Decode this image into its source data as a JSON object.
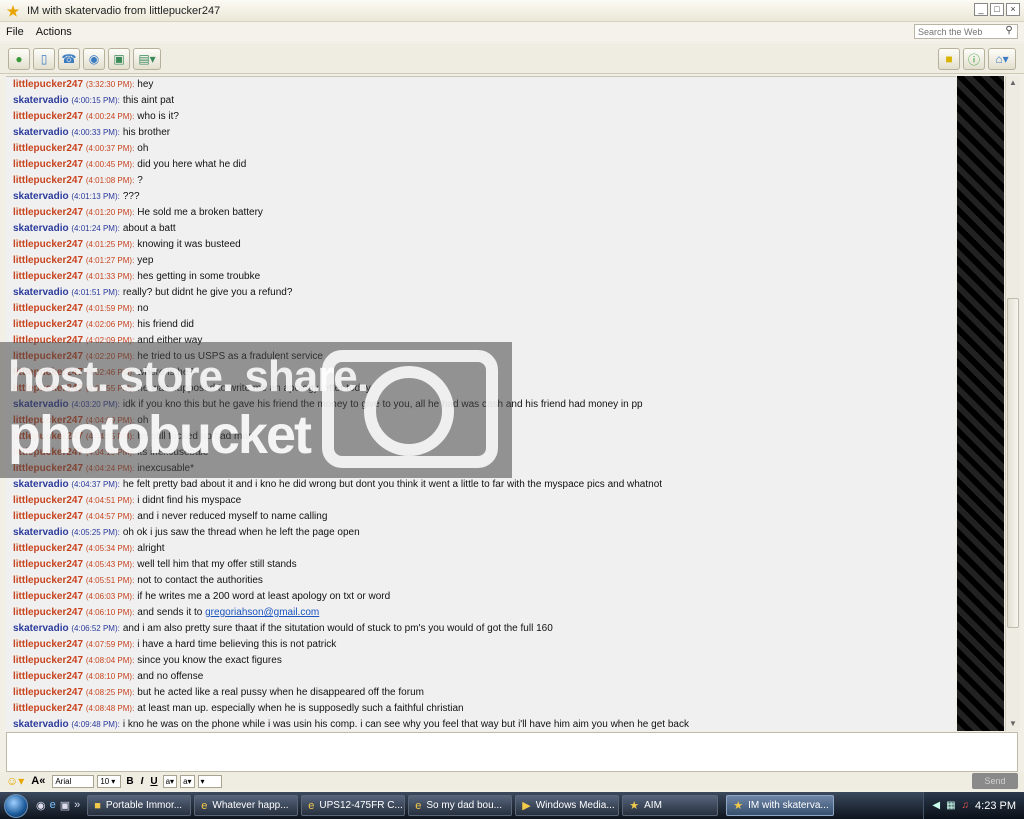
{
  "window": {
    "title": "IM with skatervadio from littlepucker247"
  },
  "menu": [
    "File",
    "Actions"
  ],
  "search": {
    "placeholder": "Search the Web"
  },
  "toolbar": {
    "left_icons": [
      "buddy-info-icon",
      "mobile-icon",
      "phone-icon",
      "video-icon",
      "image-icon",
      "share-icon"
    ],
    "right_icons": [
      "folder-icon",
      "info-icon",
      "home-icon"
    ]
  },
  "messages": [
    {
      "sn": "littlepucker247",
      "time": "(3:32:30 PM):",
      "text": "hey",
      "who": "lp"
    },
    {
      "sn": "skatervadio",
      "time": "(4:00:15 PM):",
      "text": "this aint pat",
      "who": "sk"
    },
    {
      "sn": "littlepucker247",
      "time": "(4:00:24 PM):",
      "text": "who is it?",
      "who": "lp"
    },
    {
      "sn": "skatervadio",
      "time": "(4:00:33 PM):",
      "text": "his brother",
      "who": "sk"
    },
    {
      "sn": "littlepucker247",
      "time": "(4:00:37 PM):",
      "text": "oh",
      "who": "lp"
    },
    {
      "sn": "littlepucker247",
      "time": "(4:00:45 PM):",
      "text": "did you here what he did",
      "who": "lp"
    },
    {
      "sn": "littlepucker247",
      "time": "(4:01:08 PM):",
      "text": "?",
      "who": "lp"
    },
    {
      "sn": "skatervadio",
      "time": "(4:01:13 PM):",
      "text": "???",
      "who": "sk"
    },
    {
      "sn": "littlepucker247",
      "time": "(4:01:20 PM):",
      "text": "He sold me a broken battery",
      "who": "lp"
    },
    {
      "sn": "skatervadio",
      "time": "(4:01:24 PM):",
      "text": "about a batt",
      "who": "sk"
    },
    {
      "sn": "littlepucker247",
      "time": "(4:01:25 PM):",
      "text": "knowing it was busteed",
      "who": "lp"
    },
    {
      "sn": "littlepucker247",
      "time": "(4:01:27 PM):",
      "text": "yep",
      "who": "lp"
    },
    {
      "sn": "littlepucker247",
      "time": "(4:01:33 PM):",
      "text": "hes getting in some troubke",
      "who": "lp"
    },
    {
      "sn": "skatervadio",
      "time": "(4:01:51 PM):",
      "text": "really? but didnt he give you a refund?",
      "who": "sk"
    },
    {
      "sn": "littlepucker247",
      "time": "(4:01:59 PM):",
      "text": "no",
      "who": "lp"
    },
    {
      "sn": "littlepucker247",
      "time": "(4:02:06 PM):",
      "text": "his friend did",
      "who": "lp"
    },
    {
      "sn": "littlepucker247",
      "time": "(4:02:09 PM):",
      "text": "and either way",
      "who": "lp"
    },
    {
      "sn": "littlepucker247",
      "time": "(4:02:20 PM):",
      "text": "he tried to us USPS as a fradulent service",
      "who": "lp"
    },
    {
      "sn": "littlepucker247",
      "time": "(4:02:46 PM):",
      "text": "where is he?",
      "who": "lp"
    },
    {
      "sn": "littlepucker247",
      "time": "(4:02:55 PM):",
      "text": "he was supposed to write me an apology letter today",
      "who": "lp"
    },
    {
      "sn": "skatervadio",
      "time": "(4:03:20 PM):",
      "text": "idk if you kno this but he gave his friend the money to give to you, all he had was cash and his friend had money in pp",
      "who": "sk"
    },
    {
      "sn": "littlepucker247",
      "time": "(4:04:09 PM):",
      "text": "oh",
      "who": "lp"
    },
    {
      "sn": "littlepucker247",
      "time": "(4:04:15 PM):",
      "text": "he still fucked up bad man",
      "who": "lp"
    },
    {
      "sn": "littlepucker247",
      "time": "(4:04:19 PM):",
      "text": "its inexcusebale",
      "who": "lp"
    },
    {
      "sn": "littlepucker247",
      "time": "(4:04:24 PM):",
      "text": "inexcusable*",
      "who": "lp"
    },
    {
      "sn": "skatervadio",
      "time": "(4:04:37 PM):",
      "text": "he felt pretty bad about it and i kno he did wrong but dont you think it went a little to far with the myspace pics and whatnot",
      "who": "sk"
    },
    {
      "sn": "littlepucker247",
      "time": "(4:04:51 PM):",
      "text": "i didnt find his myspace",
      "who": "lp"
    },
    {
      "sn": "littlepucker247",
      "time": "(4:04:57 PM):",
      "text": "and i never reduced myself to name calling",
      "who": "lp"
    },
    {
      "sn": "skatervadio",
      "time": "(4:05:25 PM):",
      "text": "oh ok i jus saw the thread when he left the page open",
      "who": "sk"
    },
    {
      "sn": "littlepucker247",
      "time": "(4:05:34 PM):",
      "text": "alright",
      "who": "lp"
    },
    {
      "sn": "littlepucker247",
      "time": "(4:05:43 PM):",
      "text": "well tell him that my offer still stands",
      "who": "lp"
    },
    {
      "sn": "littlepucker247",
      "time": "(4:05:51 PM):",
      "text": "not to contact the authorities",
      "who": "lp"
    },
    {
      "sn": "littlepucker247",
      "time": "(4:06:03 PM):",
      "text": "if he writes me a 200 word at least apology on txt or word",
      "who": "lp"
    },
    {
      "sn": "littlepucker247",
      "time": "(4:06:10 PM):",
      "text": "and sends it to",
      "link": "gregoriahson@gmail.com",
      "who": "lp"
    },
    {
      "sn": "skatervadio",
      "time": "(4:06:52 PM):",
      "text": "and i am also pretty sure thaat if the situtation would of stuck to pm's you would of got the full 160",
      "who": "sk"
    },
    {
      "sn": "littlepucker247",
      "time": "(4:07:59 PM):",
      "text": "i have a hard time believing this is not patrick",
      "who": "lp"
    },
    {
      "sn": "littlepucker247",
      "time": "(4:08:04 PM):",
      "text": "since you know the exact figures",
      "who": "lp"
    },
    {
      "sn": "littlepucker247",
      "time": "(4:08:10 PM):",
      "text": "and no offense",
      "who": "lp"
    },
    {
      "sn": "littlepucker247",
      "time": "(4:08:25 PM):",
      "text": "but he acted like a real pussy when he disappeared off the forum",
      "who": "lp"
    },
    {
      "sn": "littlepucker247",
      "time": "(4:08:48 PM):",
      "text": "at least man up. especially when he is supposedly such a faithful christian",
      "who": "lp"
    },
    {
      "sn": "skatervadio",
      "time": "(4:09:48 PM):",
      "text": "i kno he was on the phone while i was usin his comp. i can see why you feel that way but i'll have him aim you when he get back",
      "who": "sk"
    }
  ],
  "watermark": {
    "line1": "host. store. share.",
    "line2": "photobucket"
  },
  "format": {
    "font": "Arial",
    "size": "10",
    "bold": "B",
    "italic": "I",
    "underline": "U",
    "send": "Send"
  },
  "taskbar": {
    "tasks": [
      {
        "label": "Portable Immor...",
        "icon": "folder-icon"
      },
      {
        "label": "Whatever happ...",
        "icon": "ie-icon"
      },
      {
        "label": "UPS12-475FR C...",
        "icon": "ie-icon"
      },
      {
        "label": "So my dad bou...",
        "icon": "ie-icon"
      },
      {
        "label": "Windows Media...",
        "icon": "media-icon"
      },
      {
        "label": "AIM",
        "icon": "aim-icon"
      },
      {
        "label": "IM with skaterva...",
        "icon": "aim-icon",
        "active": true
      }
    ],
    "clock": "4:23 PM"
  }
}
